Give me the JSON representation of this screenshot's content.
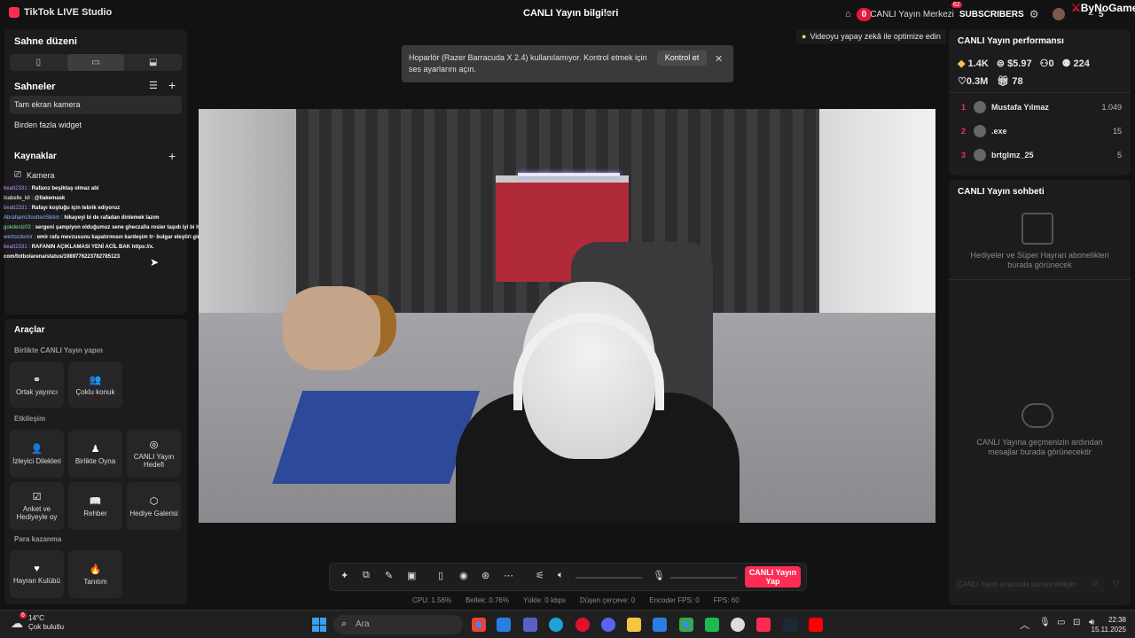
{
  "app": {
    "title": "TikTok LIVE Studio",
    "center_title": "CANLI Yayın bilgileri",
    "live_center": "CANLI Yayın Merkezi",
    "live_center_badge": "0",
    "subscribers": "SUBSCRIBERS",
    "subscriber_count": "62",
    "minimize": "–",
    "maximize": "5",
    "brand": "ByNoGame"
  },
  "left": {
    "scene_layout": "Sahne düzeni",
    "scenes_title": "Sahneler",
    "scenes": [
      "Tam ekran kamera",
      "Birden fazla widget"
    ],
    "sources_title": "Kaynaklar",
    "sources": [
      "Kamera"
    ],
    "chat": [
      {
        "user": "beatt2331",
        "msg": "Rafaxız beşiktaş olmaz abi",
        "color": "#c28cff"
      },
      {
        "user": "Isabelle_kil",
        "msg": "@Ilakemask",
        "color": "#ffffff"
      },
      {
        "user": "beatt2331",
        "msg": "Rafayı koştuğu için tebrik ediyoruz",
        "color": "#c28cff"
      },
      {
        "user": "AbrahamUtoottenSlktim",
        "msg": "hikayeyi bi de rafadan dinlemek lazım",
        "color": "#8cb4ff"
      },
      {
        "user": "gokdeniz03",
        "msg": "sergeni şampiyon olduğumuz sene gheczalla rosier taşıdı iyi bi hoca değil",
        "color": "#7fe0a0"
      },
      {
        "user": "wertozdemir",
        "msg": "emir rafa mevzusunu kapatırmısın kardeşim tr- bulgar eleştiri gir seri",
        "color": "#8cb4ff"
      },
      {
        "user": "beatt2331",
        "msg": "RAFANIN AÇIKLAMASI YENİ ACİL BAK https://x.",
        "color": "#c28cff"
      },
      {
        "user": "",
        "msg": "com/fotbolarena/status/1989776223782785123",
        "color": "#ffffff"
      }
    ],
    "tools_title": "Araçlar",
    "group1": "Birlikte CANLI Yayın yapın",
    "group2": "Etkileşim",
    "group3": "Para kazanma",
    "tools1": [
      "Ortak yayıncı",
      "Çoklu konuk"
    ],
    "tools2": [
      "İzleyici Dilekleri",
      "Birlikte Oyna",
      "CANLI Yayın Hedefi",
      "Anket ve Hediyeyle oy",
      "Rehber",
      "Hediye Galerisi"
    ],
    "tools3": [
      "Hayran Kulübü",
      "Tanıtım"
    ]
  },
  "notice": {
    "text": "Hoparlör (Razer Barracuda X 2.4) kullanılamıyor. Kontrol etmek için ses ayarlarını açın.",
    "button": "Kontrol et"
  },
  "ai_hint": "Videoyu yapay zekâ ile optimize edin",
  "right": {
    "perf_title": "CANLI Yayın performansı",
    "diamonds": "1.4K",
    "money": "$5.97",
    "viewers": "0",
    "followers": "224",
    "likes": "0.3M",
    "gifts": "78",
    "ranking": [
      {
        "rank": "1",
        "name": "Mustafa Yılmaz",
        "score": "1.049"
      },
      {
        "rank": "2",
        "name": ".exe",
        "score": "15"
      },
      {
        "rank": "3",
        "name": "brtglmz_25",
        "score": "5"
      }
    ],
    "chat_title": "CANLI Yayın sohbeti",
    "empty1": "Hediyeler ve Süper Hayran abonelikleri burada görünecek",
    "empty2": "CANLI Yayına geçmenizin ardından mesajlar burada görünecektir",
    "input_placeholder": "CANLI Yayın sırasında soruyu ekleyin"
  },
  "golive": "CANLI Yayın Yap",
  "stats": {
    "cpu": "CPU:  1.56%",
    "mem": "Bellek:  0.76%",
    "upload": "Yükle:  0 kbps",
    "dropped": "Düşen çerçeve:  0",
    "encoder": "Encoder FPS:  0",
    "fps": "FPS:  60"
  },
  "taskbar": {
    "temp": "14°C",
    "weather": "Çok bulutlu",
    "weather_badge": "6",
    "search": "Ara",
    "time": "22:38",
    "date": "15.11.2025"
  },
  "colors": {
    "accent": "#fe2c55",
    "panel": "#1c1c1e",
    "bg": "#121212"
  }
}
